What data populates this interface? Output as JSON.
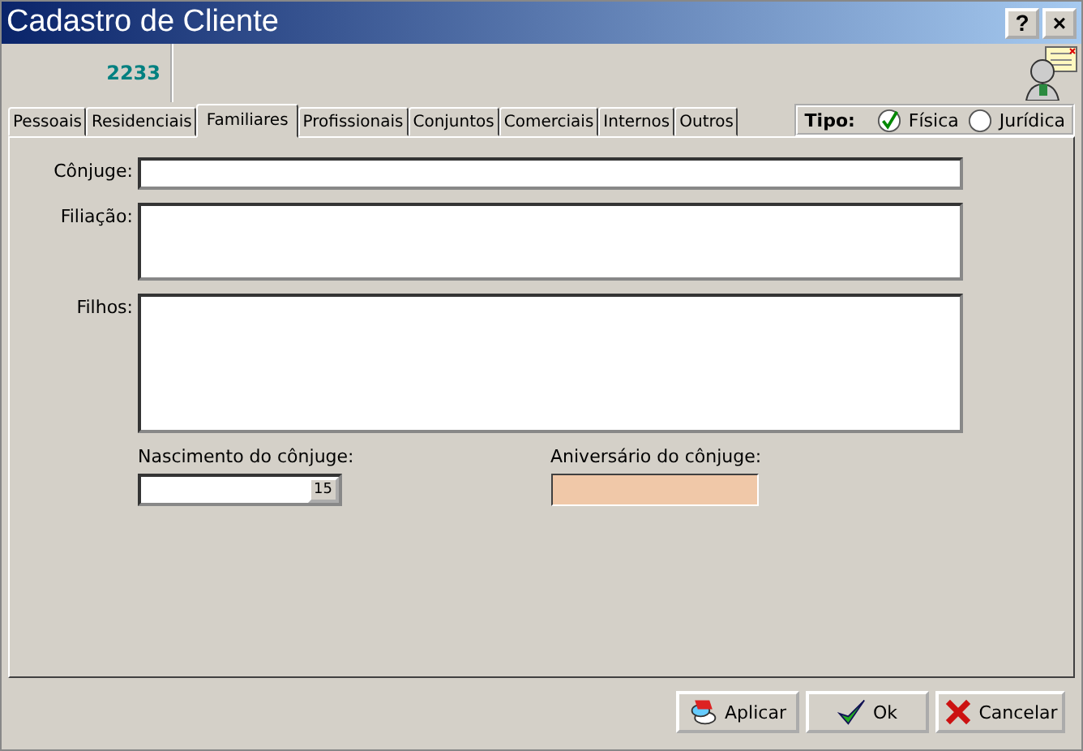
{
  "window": {
    "title": "Cadastro de Cliente",
    "help_button": "?",
    "close_button": "×"
  },
  "header": {
    "code": "2233"
  },
  "tabs": [
    {
      "label": "Pessoais",
      "selected": false
    },
    {
      "label": "Residenciais",
      "selected": false
    },
    {
      "label": "Familiares",
      "selected": true
    },
    {
      "label": "Profissionais",
      "selected": false
    },
    {
      "label": "Conjuntos",
      "selected": false
    },
    {
      "label": "Comerciais",
      "selected": false
    },
    {
      "label": "Internos",
      "selected": false
    },
    {
      "label": "Outros",
      "selected": false
    }
  ],
  "tipo": {
    "label": "Tipo:",
    "options": [
      {
        "label": "Física",
        "selected": true
      },
      {
        "label": "Jurídica",
        "selected": false
      }
    ]
  },
  "fields": [
    {
      "label": "Cônjuge:",
      "kind": "line"
    },
    {
      "label": "Filiação:",
      "kind": "area"
    },
    {
      "label": "Filhos:",
      "kind": "bigarea"
    }
  ],
  "dates": [
    {
      "label": "Nascimento do cônjuge:",
      "kind": "picker",
      "button": "15"
    },
    {
      "label": "Aniversário do cônjuge:",
      "kind": "readonly"
    }
  ],
  "buttons": [
    {
      "label": "Aplicar",
      "kind": "apply"
    },
    {
      "label": "Ok",
      "kind": "ok"
    },
    {
      "label": "Cancelar",
      "kind": "cancel"
    }
  ]
}
